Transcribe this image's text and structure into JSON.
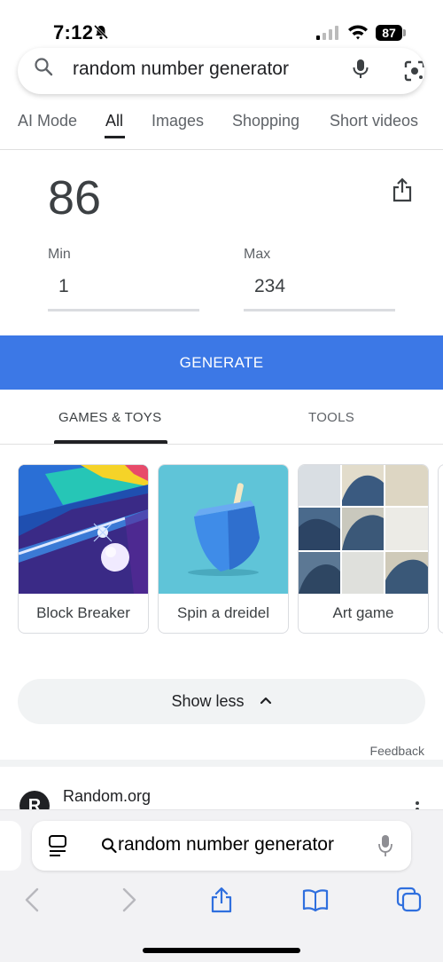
{
  "status_bar": {
    "time": "7:12",
    "battery": "87"
  },
  "search": {
    "query": "random number generator"
  },
  "tabs": [
    {
      "label": "AI Mode",
      "active": false
    },
    {
      "label": "All",
      "active": true
    },
    {
      "label": "Images",
      "active": false
    },
    {
      "label": "Shopping",
      "active": false
    },
    {
      "label": "Short videos",
      "active": false
    }
  ],
  "rng": {
    "result": "86",
    "min_label": "Min",
    "min_value": "1",
    "max_label": "Max",
    "max_value": "234",
    "generate_label": "GENERATE",
    "accent_color": "#3c78e6"
  },
  "section_tabs": [
    {
      "label": "GAMES & TOYS",
      "active": true
    },
    {
      "label": "TOOLS",
      "active": false
    }
  ],
  "games": [
    {
      "label": "Block Breaker"
    },
    {
      "label": "Spin a dreidel"
    },
    {
      "label": "Art game"
    }
  ],
  "show_less_label": "Show less",
  "feedback_label": "Feedback",
  "result": {
    "site_name": "Random.org",
    "site_initial": "R"
  },
  "safari": {
    "url_text": "random number generator"
  }
}
